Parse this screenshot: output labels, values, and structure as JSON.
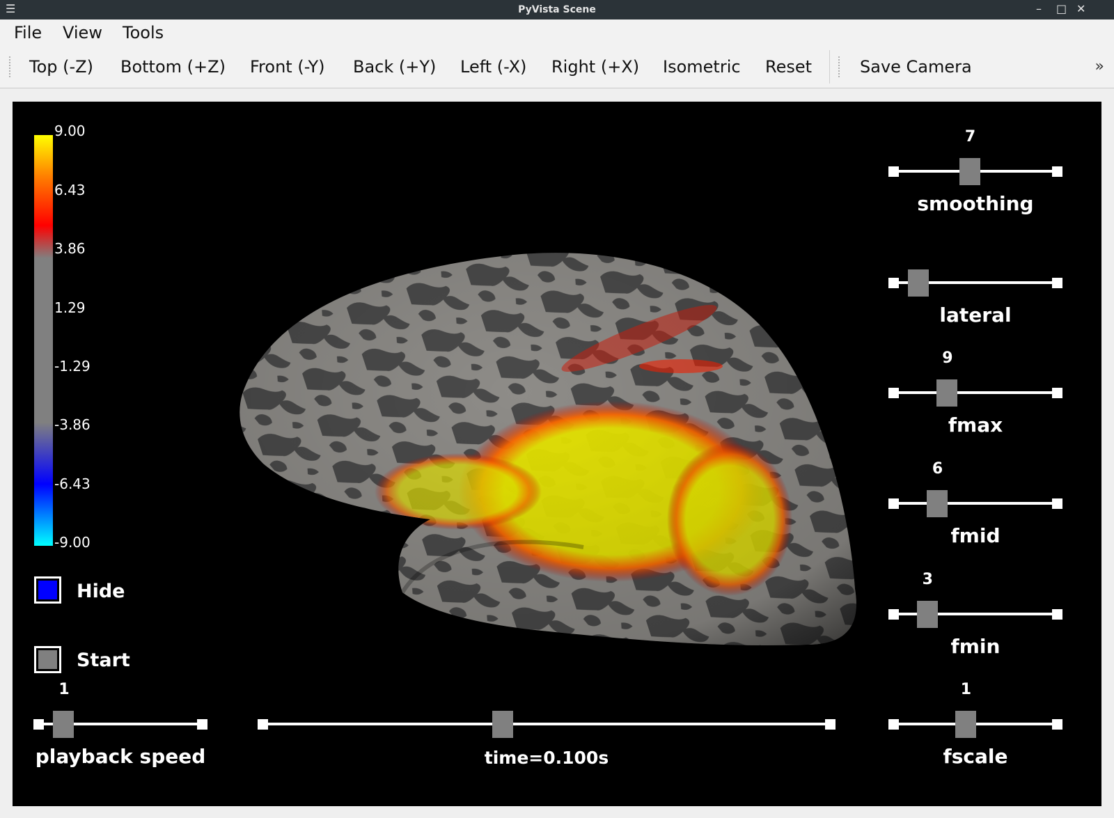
{
  "window": {
    "title": "PyVista Scene"
  },
  "menu": [
    "File",
    "View",
    "Tools"
  ],
  "toolbar": {
    "buttons": [
      "Top (-Z)",
      "Bottom (+Z)",
      "Front (-Y)",
      "Back (+Y)",
      "Left (-X)",
      "Right (+X)",
      "Isometric",
      "Reset"
    ],
    "save_camera": "Save Camera"
  },
  "colorbar": {
    "ticks": [
      "9.00",
      "6.43",
      "3.86",
      "1.29",
      "-1.29",
      "-3.86",
      "-6.43",
      "-9.00"
    ],
    "colors": [
      "#ffff00",
      "#ff0000",
      "#808080",
      "#0000ff",
      "#00ffff"
    ]
  },
  "checkboxes": {
    "hide": {
      "label": "Hide",
      "color": "#0000ff"
    },
    "start": {
      "label": "Start",
      "color": "#808080"
    }
  },
  "sliders": {
    "smoothing": {
      "label": "smoothing",
      "value": "7",
      "fraction": 0.46
    },
    "lateral": {
      "label": "lateral",
      "value": "",
      "fraction": 0.1
    },
    "fmax": {
      "label": "fmax",
      "value": "9",
      "fraction": 0.3
    },
    "fmid": {
      "label": "fmid",
      "value": "6",
      "fraction": 0.23
    },
    "fmin": {
      "label": "fmin",
      "value": "3",
      "fraction": 0.16
    },
    "fscale": {
      "label": "fscale",
      "value": "1",
      "fraction": 0.43
    },
    "playback": {
      "label": "playback speed",
      "value": "1",
      "fraction": 0.1
    },
    "time": {
      "label": "time=0.100s",
      "value": "",
      "fraction": 0.42
    }
  }
}
